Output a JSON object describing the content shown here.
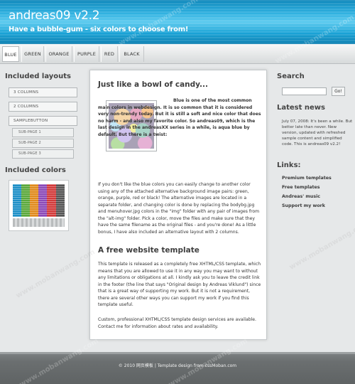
{
  "header": {
    "title": "andreas09 v2.2",
    "tagline": "Have a bubble-gum - six colors to choose from!"
  },
  "nav": {
    "items": [
      "BLUE",
      "GREEN",
      "ORANGE",
      "PURPLE",
      "RED",
      "BLACK"
    ],
    "active": "BLUE"
  },
  "left": {
    "layouts_heading": "Included layouts",
    "layouts": [
      "3 COLUMNS",
      "2 COLUMNS",
      "SAMPLEBUTTON"
    ],
    "subpages": [
      "SUB-PAGE 1",
      "SUB-PAGE 2",
      "SUB-PAGE 3"
    ],
    "colors_heading": "Included colors",
    "swatch_colors": [
      "#1d8fc7",
      "#5aa83b",
      "#e08a1c",
      "#8b49b8",
      "#d23a3a",
      "#555555"
    ]
  },
  "main": {
    "heading1": "Just like a bowl of candy...",
    "intro_bold": "Blue is one of the most common main colors in webdesign. It is so common that it is considered very non-trendy today. But it is still a soft and nice color that does no harm - and also my favorite color. So andreas09, which is the last design in the andreasXX series in a while, is aqua blue by default. But there is a twist:",
    "para1": "If you don't like the blue colors you can easily change to another color using any of the attached alternative background image pairs: green, orange, purple, red or black! The alternative images are located in a separate folder, and changing color is done by replacing the bodybg.jpg and menuhover.jpg colors in the \"img\" folder with any pair of images from the \"alt-img\" folder. Pick a color, move the files and make sure that they have the same filename as the original files - and you're done! As a little bonus, I have also included an alternative layout with 2 columns.",
    "heading2": "A free website template",
    "para2": "This template is released as a completely free XHTML/CSS template, which means that you are allowed to use it in any way you may want to without any limitations or obligations at all. I kindly ask you to leave the credit link in the footer (the line that says \"Original design by Andreas Viklund\") since that is a great way of supporting my work. But it is not a requirement, there are several other ways you can support my work if you find this template useful.",
    "para3": "Custom, professional XHTML/CSS template design services are available. Contact me for information about rates and availability."
  },
  "right": {
    "search_heading": "Search",
    "search_value": "",
    "go_label": "Go!",
    "news_heading": "Latest news",
    "news_text": "July 07, 2008: It's been a while. But better late than never. New version, updated with refreshed sample content and simplified code. This is andreas09 v2.2!",
    "links_heading": "Links:",
    "links": [
      "Premium templates",
      "Free templates",
      "Andreas' music",
      "Support my work"
    ]
  },
  "footer": {
    "text": "© 2010 网页模板 | Template design from cssMoban.com"
  },
  "watermark": "www.mobanwang.com"
}
